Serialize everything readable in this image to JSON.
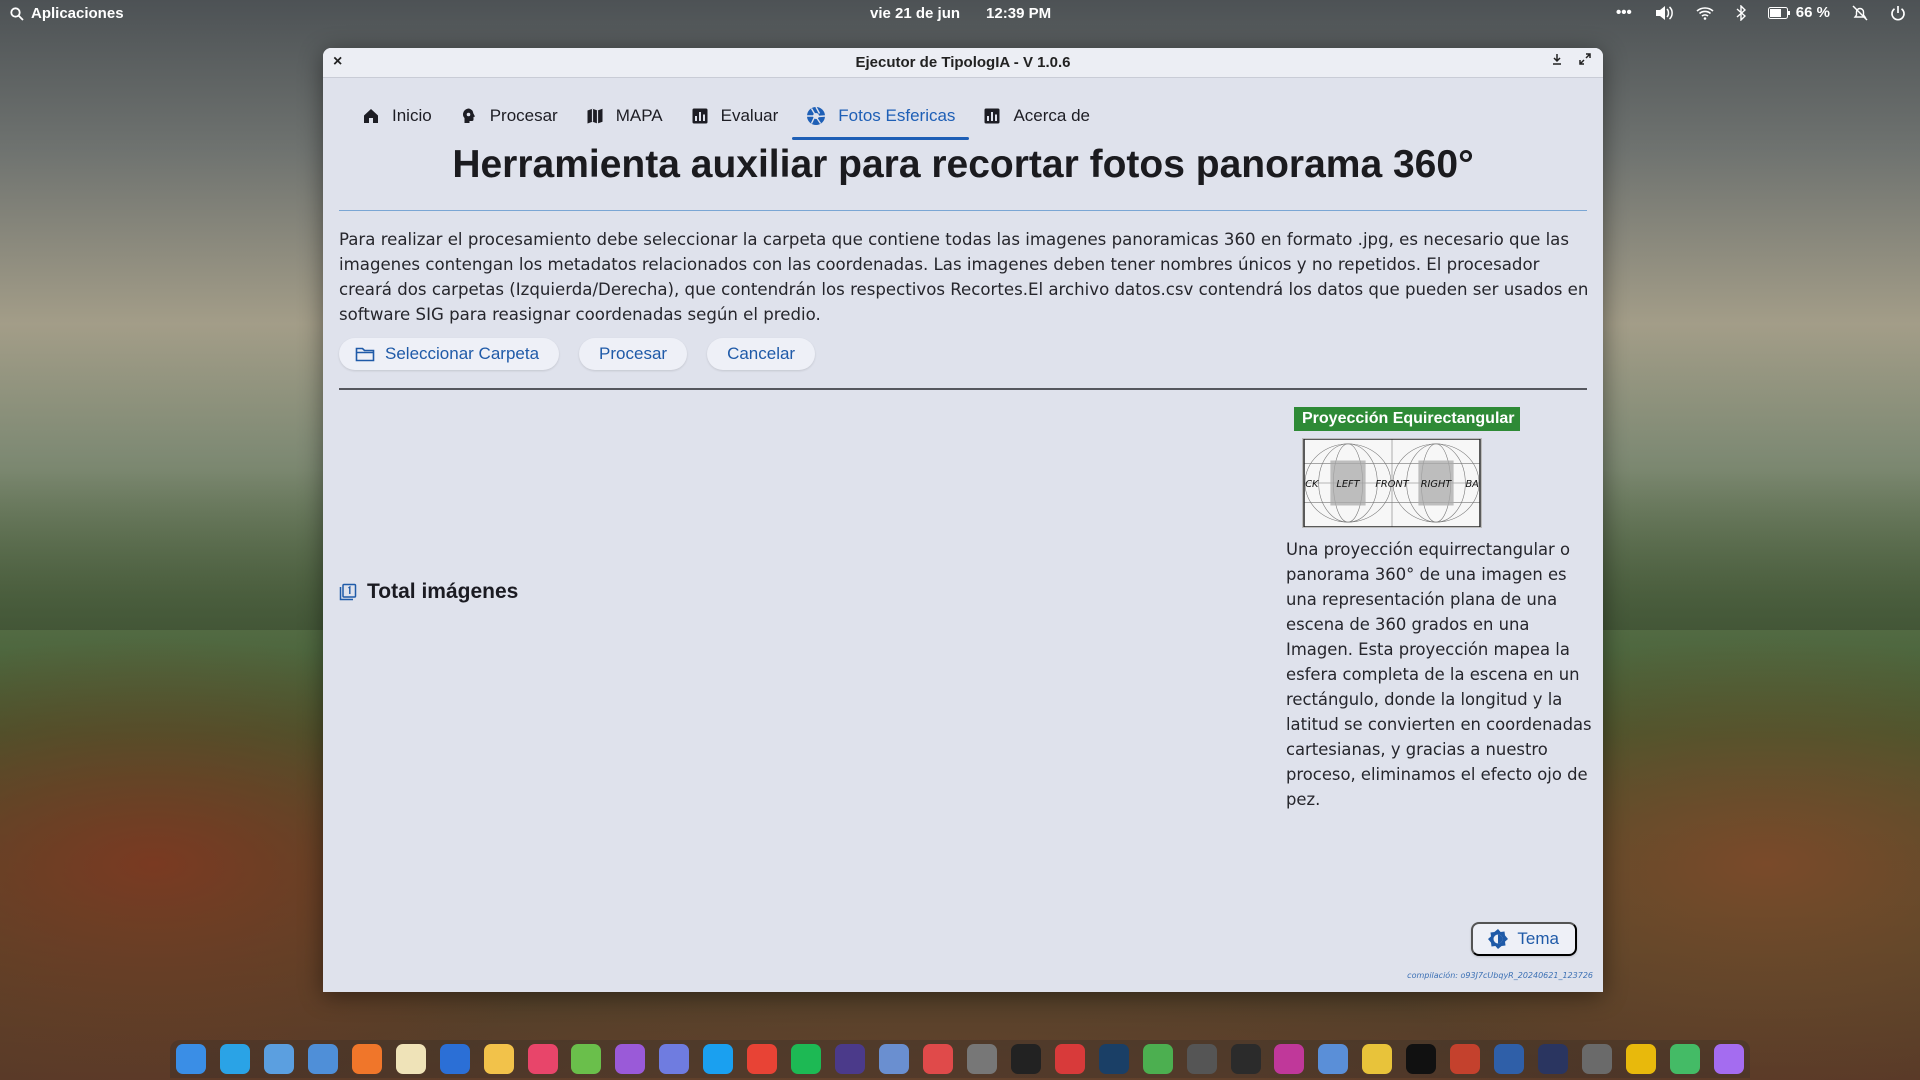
{
  "topbar": {
    "apps_label": "Aplicaciones",
    "date": "vie 21 de jun",
    "time": "12:39 PM",
    "battery": "66 %"
  },
  "window": {
    "title": "Ejecutor de TipologIA - V 1.0.6",
    "close_glyph": "×"
  },
  "tabs": [
    {
      "label": "Inicio",
      "icon": "home-icon"
    },
    {
      "label": "Procesar",
      "icon": "brain-icon"
    },
    {
      "label": "MAPA",
      "icon": "map-icon"
    },
    {
      "label": "Evaluar",
      "icon": "chart-icon"
    },
    {
      "label": "Fotos Esfericas",
      "icon": "aperture-icon",
      "active": true
    },
    {
      "label": "Acerca de",
      "icon": "chart-icon"
    }
  ],
  "main": {
    "heading": "Herramienta auxiliar para recortar fotos panorama 360°",
    "description": "Para realizar el procesamiento debe seleccionar la carpeta que contiene todas las imagenes panoramicas 360 en formato .jpg, es necesario que las imagenes contengan los metadatos relacionados con las coordenadas. Las imagenes deben tener nombres únicos y no repetidos. El procesador creará dos carpetas (Izquierda/Derecha), que contendrán los respectivos Recortes.El archivo datos.csv contendrá los datos que pueden ser usados en software SIG para reasignar coordenadas según el predio.",
    "buttons": {
      "select_folder": "Seleccionar Carpeta",
      "process": "Procesar",
      "cancel": "Cancelar"
    },
    "total_label": "Total imágenes"
  },
  "side": {
    "badge": "Proyección Equirectangular",
    "proj_labels": [
      "CK",
      "LEFT",
      "FRONT",
      "RIGHT",
      "BA"
    ],
    "text": "Una proyección equirrectangular o panorama 360° de una imagen es una representación plana de una escena de 360 grados en una Imagen. Esta proyección mapea la esfera completa de la escena en un rectángulo, donde la longitud y la latitud se convierten en coordenadas cartesianas, y gracias a nuestro proceso, eliminamos el efecto ojo de pez."
  },
  "footer": {
    "theme_button": "Tema",
    "build": "compilación: o93J7cUbqyR_20240621_123726"
  },
  "dock_colors": [
    "#3a8ee6",
    "#2aa3e6",
    "#5b9fe0",
    "#4f8fd8",
    "#f0762a",
    "#efe3b8",
    "#2b6fd6",
    "#f2c24a",
    "#e8456a",
    "#6abf4b",
    "#9a5ad8",
    "#6f7ce0",
    "#1aa0f0",
    "#e84335",
    "#1db954",
    "#4b3a8a",
    "#6a8fd0",
    "#e04a4a",
    "#777777",
    "#222222",
    "#d83a3a",
    "#1a3f66",
    "#4caf50",
    "#555555",
    "#2b2b2b",
    "#c0389a",
    "#5a8fd8",
    "#e8c33a",
    "#111111",
    "#c4412d",
    "#2f5fa8",
    "#2a3560",
    "#6a6a6a",
    "#e8b90c",
    "#44bb66",
    "#a46cf0"
  ]
}
